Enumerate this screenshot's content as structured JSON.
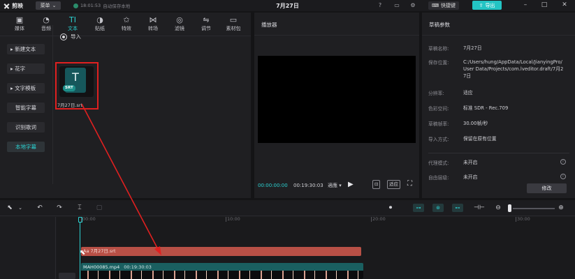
{
  "app": {
    "name": "剪映",
    "menu_label": "菜单",
    "autosave_time": "18:01:53",
    "autosave_text": "自动保存本地",
    "project_title": "7月27日",
    "shortcut_label": "快捷键",
    "export_label": "导出"
  },
  "media_tabs": [
    {
      "label": "媒体",
      "icon": "media-icon",
      "glyph": "▣"
    },
    {
      "label": "音频",
      "icon": "audio-icon",
      "glyph": "◔"
    },
    {
      "label": "文本",
      "icon": "text-icon",
      "glyph": "TI"
    },
    {
      "label": "贴纸",
      "icon": "sticker-icon",
      "glyph": "◑"
    },
    {
      "label": "特效",
      "icon": "effects-icon",
      "glyph": "✩"
    },
    {
      "label": "转场",
      "icon": "transition-icon",
      "glyph": "⋈"
    },
    {
      "label": "滤镜",
      "icon": "filter-icon",
      "glyph": "◎"
    },
    {
      "label": "调节",
      "icon": "adjust-icon",
      "glyph": "⇋"
    },
    {
      "label": "素材包",
      "icon": "material-pack-icon",
      "glyph": "▭"
    }
  ],
  "text_sidebar": [
    {
      "label": "▸ 新建文本"
    },
    {
      "label": "▸ 花字"
    },
    {
      "label": "▸ 文字模板"
    },
    {
      "label": "智能字幕"
    },
    {
      "label": "识别歌词"
    },
    {
      "label": "本地字幕"
    }
  ],
  "import_label": "导入",
  "media_item": {
    "letter": "T",
    "tag": "SRT",
    "filename": "7月27日.srt"
  },
  "player": {
    "title": "播放器",
    "current_time": "00:00:00:00",
    "total_time": "00:19:30:03",
    "fit_label": "適應 ▾",
    "btn_a": "⊡",
    "btn_b": "适应"
  },
  "params": {
    "title": "草稿参数",
    "rows": [
      {
        "label": "草稿名称:",
        "value": "7月27日"
      },
      {
        "label": "保存位置:",
        "value": "C:/Users/hung/AppData/Local/JianyingPro/User Data/Projects/com.lveditor.draft/7月27日"
      },
      {
        "label": "分辨率:",
        "value": "适应"
      },
      {
        "label": "色彩空间:",
        "value": "标准 SDR - Rec.709"
      },
      {
        "label": "草稿帧率:",
        "value": "30.00帧/秒"
      },
      {
        "label": "导入方式:",
        "value": "保留在原有位置"
      },
      {
        "label": "代理模式:",
        "value": "未开启"
      },
      {
        "label": "自由层级:",
        "value": "未开启"
      }
    ],
    "edit_label": "修改"
  },
  "timeline": {
    "ruler": [
      "00:00",
      "10:00",
      "20:00",
      "30:00"
    ],
    "subtitle_clip": "Aa 7月27日.srt",
    "video_clip_name": "MAH00085.mp4",
    "video_clip_duration": "00:19:30:03"
  },
  "colors": {
    "accent": "#2bd1d1",
    "highlight_box": "#e02020",
    "subtitle_clip": "#b85046",
    "video_clip": "#1a5f60"
  }
}
